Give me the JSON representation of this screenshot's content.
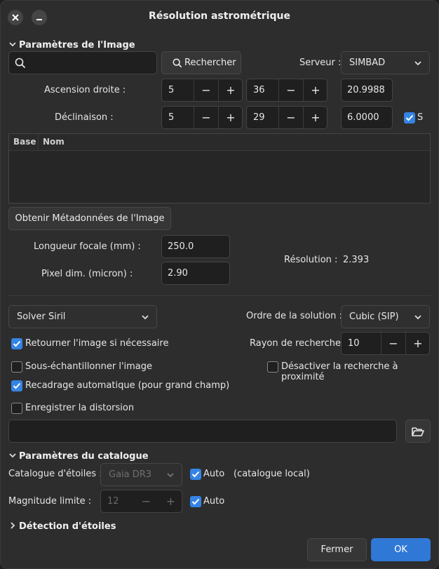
{
  "window": {
    "title": "Résolution astrométrique",
    "close_icon": "close-icon",
    "minimize_icon": "minimize-icon"
  },
  "image_params": {
    "header": "Paramètres de l'Image",
    "search_placeholder": "",
    "search_button": "Rechercher",
    "server_label": "Serveur :",
    "server_value": "SIMBAD",
    "ra_label": "Ascension droite :",
    "ra_h": "5",
    "ra_m": "36",
    "ra_s": "20.9988",
    "dec_label": "Déclinaison :",
    "dec_d": "5",
    "dec_m": "29",
    "dec_s": "6.0000",
    "south_label": "S",
    "south_checked": true,
    "table_headers": [
      "Base",
      "Nom"
    ],
    "metadata_button": "Obtenir Métadonnées de l'Image",
    "focal_label": "Longueur focale (mm) :",
    "focal_value": "250.0",
    "pixel_label": "Pixel dim. (micron) :",
    "pixel_value": "2.90",
    "resolution_label": "Résolution :",
    "resolution_value": "2.393"
  },
  "solver": {
    "solver_value": "Solver Siril",
    "order_label": "Ordre de la solution :",
    "order_value": "Cubic (SIP)",
    "flip_label": "Retourner l'image si nécessaire",
    "flip_checked": true,
    "radius_label": "Rayon de recherche :",
    "radius_value": "10",
    "downsample_label": "Sous-échantillonner l'image",
    "downsample_checked": false,
    "disable_near_label": "Désactiver la recherche à proximité",
    "disable_near_checked": false,
    "autocrop_label": "Recadrage automatique (pour grand champ)",
    "autocrop_checked": true,
    "save_distortion_label": "Enregistrer la distorsion",
    "save_distortion_checked": false,
    "distortion_path": ""
  },
  "catalog": {
    "header": "Paramètres du catalogue",
    "catalog_label": "Catalogue d'étoiles :",
    "catalog_value": "Gaia DR3",
    "catalog_auto_label": "Auto",
    "catalog_auto_checked": true,
    "catalog_note": "(catalogue local)",
    "mag_label": "Magnitude limite :",
    "mag_value": "12",
    "mag_auto_label": "Auto",
    "mag_auto_checked": true
  },
  "star_detection": {
    "header": "Détection d'étoiles"
  },
  "footer": {
    "close_button": "Fermer",
    "ok_button": "OK"
  },
  "colors": {
    "accent": "#3584e4",
    "ok_button": "#2f78d6",
    "background": "#2d2d2d"
  }
}
